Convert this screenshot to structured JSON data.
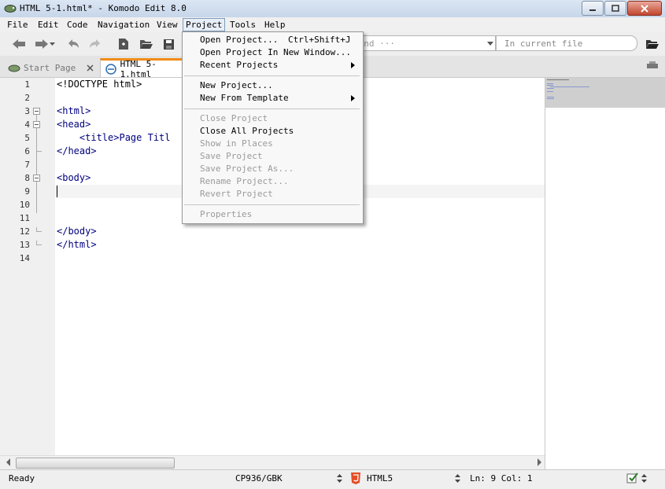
{
  "window": {
    "title": "HTML 5-1.html* - Komodo Edit 8.0"
  },
  "menubar": {
    "items": [
      "File",
      "Edit",
      "Code",
      "Navigation",
      "View",
      "Project",
      "Tools",
      "Help"
    ]
  },
  "toolbar": {
    "find_placeholder": "Find ···",
    "scope_label": "In current file"
  },
  "tabs": [
    {
      "label": "Start Page"
    },
    {
      "label": "HTML 5-1.html"
    }
  ],
  "editor": {
    "line_numbers": [
      "1",
      "2",
      "3",
      "4",
      "5",
      "6",
      "7",
      "8",
      "9",
      "10",
      "11",
      "12",
      "13",
      "14"
    ],
    "lines": [
      "<!DOCTYPE html>",
      "",
      "<html>",
      "<head>",
      "    <title>Page Titl",
      "</head>",
      "",
      "<body>",
      "",
      "",
      "",
      "</body>",
      "</html>",
      ""
    ]
  },
  "project_menu": {
    "open_project": "Open Project...",
    "open_project_accel": "Ctrl+Shift+J",
    "open_project_new_window": "Open Project In New Window...",
    "recent_projects": "Recent Projects",
    "new_project": "New Project...",
    "new_from_template": "New From Template",
    "close_project": "Close Project",
    "close_all_projects": "Close All Projects",
    "show_in_places": "Show in Places",
    "save_project": "Save Project",
    "save_project_as": "Save Project As...",
    "rename_project": "Rename Project...",
    "revert_project": "Revert Project",
    "properties": "Properties"
  },
  "statusbar": {
    "status": "Ready",
    "encoding": "CP936/GBK",
    "language": "HTML5",
    "position": "Ln: 9 Col: 1"
  },
  "colors": {
    "tag": "#000080",
    "tab_accent": "#f08c18",
    "menu_highlight": "#e8eef7"
  }
}
